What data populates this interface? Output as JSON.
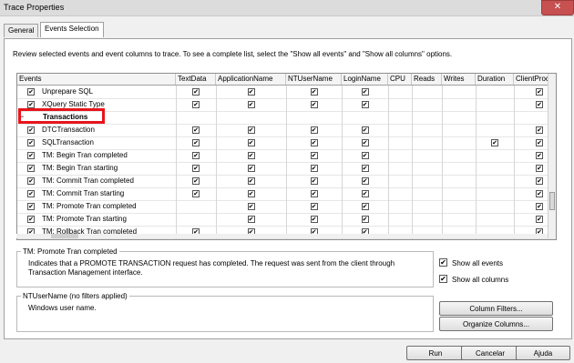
{
  "window": {
    "title": "Trace Properties",
    "close_glyph": "✕"
  },
  "tabs": [
    {
      "label": "General"
    },
    {
      "label": "Events Selection"
    }
  ],
  "instructions": "Review selected events and event columns to trace. To see a complete list, select the \"Show all events\" and \"Show all columns\" options.",
  "grid": {
    "columns": [
      "Events",
      "TextData",
      "ApplicationName",
      "NTUserName",
      "LoginName",
      "CPU",
      "Reads",
      "Writes",
      "Duration",
      "ClientProc"
    ],
    "rows": [
      {
        "label": "Unprepare SQL",
        "checked": true,
        "cells": [
          true,
          true,
          true,
          true,
          false,
          false,
          false,
          false,
          true
        ]
      },
      {
        "label": "XQuery Static Type",
        "checked": true,
        "cells": [
          true,
          true,
          true,
          true,
          false,
          false,
          false,
          false,
          true
        ]
      },
      {
        "label": "Transactions",
        "category": true
      },
      {
        "label": "DTCTransaction",
        "checked": true,
        "cells": [
          true,
          true,
          true,
          true,
          false,
          false,
          false,
          false,
          true
        ]
      },
      {
        "label": "SQLTransaction",
        "checked": true,
        "cells": [
          true,
          true,
          true,
          true,
          false,
          false,
          false,
          true,
          true
        ]
      },
      {
        "label": "TM: Begin Tran completed",
        "checked": true,
        "cells": [
          true,
          true,
          true,
          true,
          false,
          false,
          false,
          false,
          true
        ]
      },
      {
        "label": "TM: Begin Tran starting",
        "checked": true,
        "cells": [
          true,
          true,
          true,
          true,
          false,
          false,
          false,
          false,
          true
        ]
      },
      {
        "label": "TM: Commit Tran completed",
        "checked": true,
        "cells": [
          true,
          true,
          true,
          true,
          false,
          false,
          false,
          false,
          true
        ]
      },
      {
        "label": "TM: Commit Tran starting",
        "checked": true,
        "cells": [
          true,
          true,
          true,
          true,
          false,
          false,
          false,
          false,
          true
        ]
      },
      {
        "label": "TM: Promote Tran completed",
        "checked": true,
        "cells": [
          false,
          true,
          true,
          true,
          false,
          false,
          false,
          false,
          true
        ]
      },
      {
        "label": "TM: Promote Tran starting",
        "checked": true,
        "cells": [
          false,
          true,
          true,
          true,
          false,
          false,
          false,
          false,
          true
        ]
      },
      {
        "label": "TM: Rollback Tran completed",
        "checked": true,
        "cells": [
          true,
          true,
          true,
          true,
          false,
          false,
          false,
          false,
          true
        ]
      }
    ]
  },
  "description": {
    "title": "TM: Promote Tran completed",
    "text": "Indicates that a PROMOTE TRANSACTION request has completed. The request was sent from the client through Transaction Management interface."
  },
  "options": {
    "show_all_events": "Show all events",
    "show_all_columns": "Show all columns"
  },
  "filter_group": {
    "title": "NTUserName (no filters applied)",
    "text": "Windows user name."
  },
  "buttons": {
    "column_filters": "Column Filters...",
    "organize_columns": "Organize Columns...",
    "run": "Run",
    "cancel": "Cancelar",
    "help": "Ajuda"
  },
  "check_glyph": "✔"
}
